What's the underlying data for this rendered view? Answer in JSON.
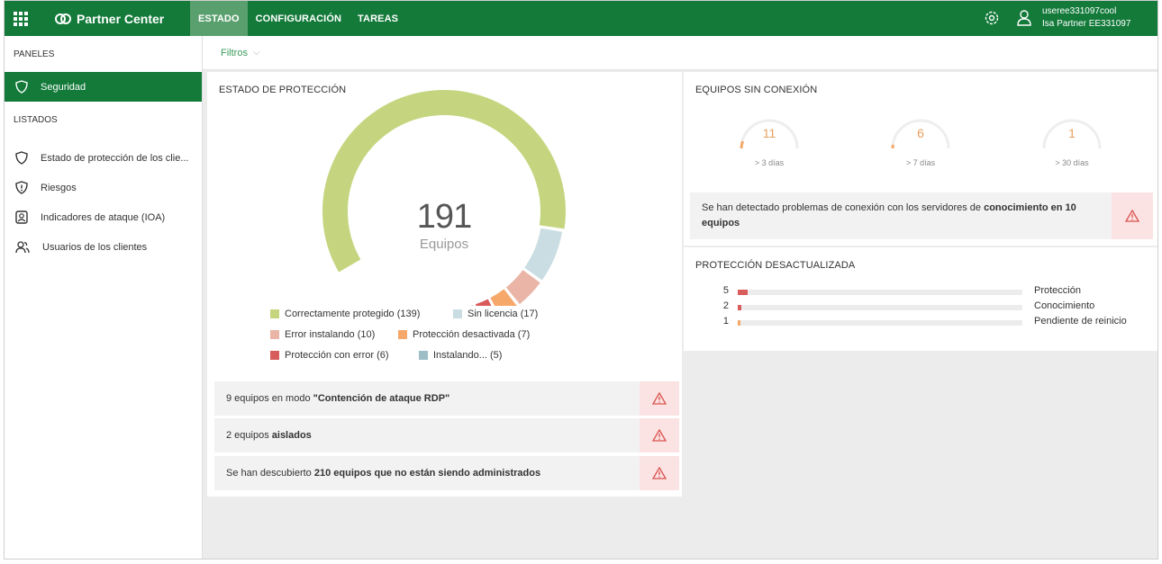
{
  "topbar": {
    "app_name": "Partner Center",
    "nav": [
      "ESTADO",
      "CONFIGURACIÓN",
      "TAREAS"
    ],
    "user_name": "useree331097cool",
    "user_org": "Isa Partner EE331097",
    "icons": [
      "apps-grid-icon",
      "partner-logo-icon",
      "settings-gear-icon",
      "user-icon"
    ]
  },
  "sidebar": {
    "panels_heading": "PANELES",
    "active_item": "Seguridad",
    "lists_heading": "LISTADOS",
    "items": [
      "Estado de protección de los clie...",
      "Riesgos",
      "Indicadores de ataque (IOA)",
      "Usuarios de los clientes"
    ]
  },
  "filters": {
    "label": "Filtros",
    "chevron": "⌵"
  },
  "protection": {
    "title": "ESTADO DE PROTECCIÓN",
    "total": "191",
    "total_label": "Equipos",
    "legend": [
      "Correctamente protegido (139)",
      "Sin licencia (17)",
      "Error instalando (10)",
      "Protección desactivada (7)",
      "Protección con error (6)",
      "Instalando... (5)"
    ],
    "segments": [
      {
        "value": 139,
        "color": "#c5d57f"
      },
      {
        "value": 17,
        "color": "#c9dde2"
      },
      {
        "value": 10,
        "color": "#eab5a6"
      },
      {
        "value": 7,
        "color": "#f5a86a"
      },
      {
        "value": 6,
        "color": "#d95c5c"
      },
      {
        "value": 5,
        "color": "#9dbec6"
      }
    ],
    "alerts": [
      {
        "pre": "9 equipos en modo ",
        "bold": "\"Contención de ataque RDP\"",
        "post": ""
      },
      {
        "pre": "2 equipos ",
        "bold": "aislados",
        "post": ""
      },
      {
        "pre": "Se han descubierto ",
        "bold": "210 equipos que no están siendo administrados",
        "post": ""
      }
    ]
  },
  "offline": {
    "title": "EQUIPOS SIN CONEXIÓN",
    "gauges": [
      {
        "value": "11",
        "label": "> 3 días"
      },
      {
        "value": "6",
        "label": "> 7 días"
      },
      {
        "value": "1",
        "label": "> 30 días"
      }
    ],
    "alert_pre": "Se han detectado problemas de conexión con los servidores de ",
    "alert_bold": "conocimiento en 10 equipos"
  },
  "outdated": {
    "title": "PROTECCIÓN DESACTUALIZADA",
    "rows": [
      {
        "count": "5",
        "label": "Protección",
        "value": 5,
        "color": "#d95c5c"
      },
      {
        "count": "2",
        "label": "Conocimiento",
        "value": 2,
        "color": "#d95c5c"
      },
      {
        "count": "1",
        "label": "Pendiente de reinicio",
        "value": 1,
        "color": "#f5a86a"
      }
    ]
  },
  "colors": {
    "brand": "#137a3a",
    "nav_active": "#5aa06f",
    "alert_bg": "#fbe3e3",
    "alert_icon": "#d9534f"
  }
}
